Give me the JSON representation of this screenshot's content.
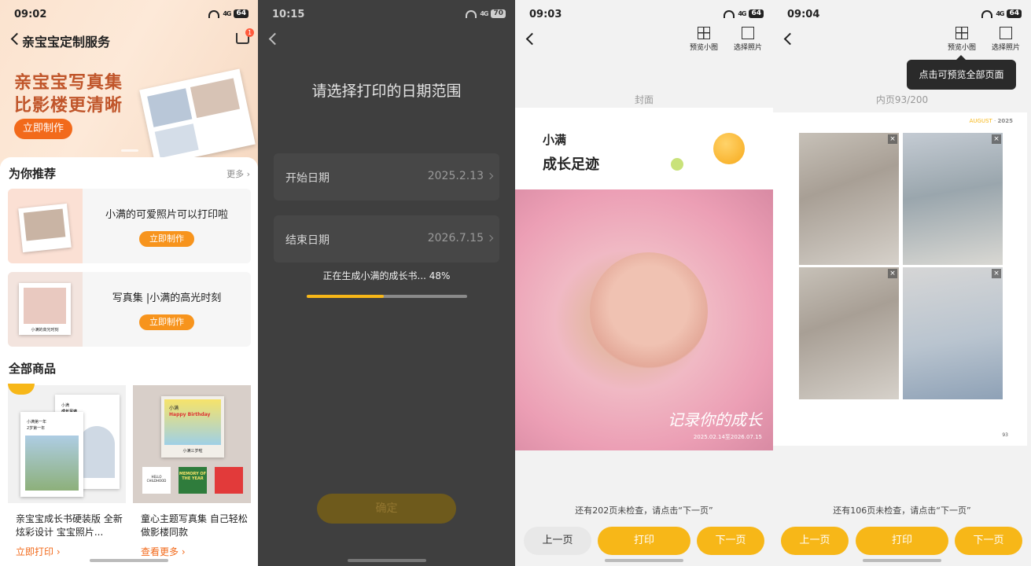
{
  "screen1": {
    "status": {
      "time": "09:02",
      "network": "4G",
      "battery": "64"
    },
    "title": "亲宝宝定制服务",
    "cart_badge": "1",
    "banner": {
      "line1": "亲宝宝写真集",
      "line2": "比影楼更清晰",
      "button": "立即制作"
    },
    "recommend": {
      "title": "为你推荐",
      "more": "更多",
      "items": [
        {
          "title": "小满的可爱照片可以打印啦",
          "button": "立即制作"
        },
        {
          "title": "写真集 |小满的高光时刻",
          "button": "立即制作",
          "thumb_caption": "小满的高光时刻"
        }
      ]
    },
    "all_products": {
      "title": "全部商品",
      "items": [
        {
          "title": "亲宝宝成长书硬装版 全新炫彩设计 宝宝照片...",
          "link": "立即打印",
          "cover_text_1": "小满",
          "cover_text_2": "成长足迹",
          "cover_text_3": "小满第一年",
          "cover_text_4": "2岁第一年"
        },
        {
          "title": "童心主题写真集 自己轻松做影楼同款",
          "link": "查看更多",
          "card_1": "HELLO CHILDHOOD",
          "card_2": "MEMORY OF THE YEAR",
          "book_text_1": "小满",
          "book_text_2": "Happy Birthday",
          "book_text_3": "小满三岁啦"
        }
      ]
    }
  },
  "screen2": {
    "status": {
      "time": "10:15",
      "network": "4G",
      "battery": "70"
    },
    "heading": "请选择打印的日期范围",
    "start": {
      "label": "开始日期",
      "value": "2025.2.13"
    },
    "end": {
      "label": "结束日期",
      "value": "2026.7.15"
    },
    "progress": {
      "text": "正在生成小满的成长书... 48%",
      "percent": 48
    },
    "confirm": "确定"
  },
  "screen3": {
    "status": {
      "time": "09:03",
      "network": "4G",
      "battery": "64"
    },
    "tools": {
      "preview": "预览小图",
      "select": "选择照片"
    },
    "page_label": "封面",
    "cover": {
      "name": "小满",
      "subtitle": "成长足迹",
      "script": "记录你的成长",
      "date": "2025.02.14至2026.07.15"
    },
    "hint": "还有202页未检查，请点击“下一页”",
    "buttons": {
      "prev": "上一页",
      "print": "打印",
      "next": "下一页"
    }
  },
  "screen4": {
    "status": {
      "time": "09:04",
      "network": "4G",
      "battery": "64"
    },
    "tools": {
      "preview": "预览小图",
      "select": "选择照片"
    },
    "tooltip": "点击可预览全部页面",
    "page_label": "内页93/200",
    "inner": {
      "month": "AUGUST",
      "year": "2025",
      "page_number": "93",
      "remove_icon": "×"
    },
    "hint": "还有106页未检查，请点击“下一页”",
    "buttons": {
      "prev": "上一页",
      "print": "打印",
      "next": "下一页"
    }
  }
}
